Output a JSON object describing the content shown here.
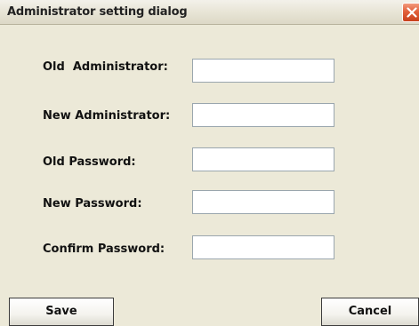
{
  "window": {
    "title": "Administrator setting dialog"
  },
  "form": {
    "fields": [
      {
        "label": "Old  Administrator:",
        "value": "",
        "placeholder": ""
      },
      {
        "label": "New Administrator:",
        "value": "",
        "placeholder": ""
      },
      {
        "label": "Old Password:",
        "value": "",
        "placeholder": ""
      },
      {
        "label": "New Password:",
        "value": "",
        "placeholder": ""
      },
      {
        "label": "Confirm Password:",
        "value": "",
        "placeholder": ""
      }
    ]
  },
  "buttons": {
    "save_label": "Save",
    "cancel_label": "Cancel"
  },
  "icons": {
    "close": "close-icon"
  },
  "colors": {
    "dialog_background": "#ece9d8",
    "close_button": "#e2603b"
  }
}
